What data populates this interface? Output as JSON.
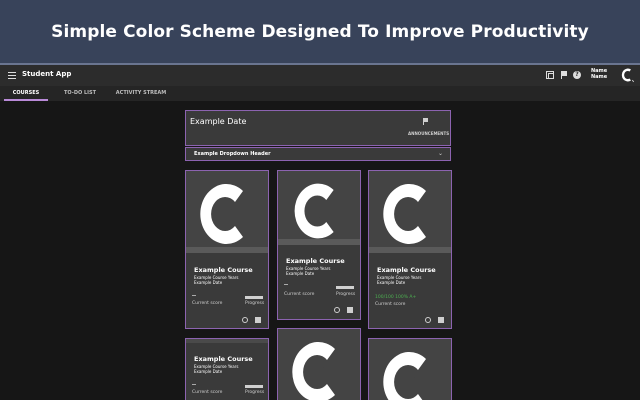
{
  "banner": {
    "text": "Simple Color Scheme Designed To Improve Productivity"
  },
  "app": {
    "title": "Student App",
    "user_name": "Name Name",
    "icons": [
      "menu-icon",
      "cards-icon",
      "flag-icon",
      "help-icon",
      "avatar-logo"
    ]
  },
  "tabs": [
    {
      "label": "COURSES",
      "active": true
    },
    {
      "label": "TO-DO LIST",
      "active": false
    },
    {
      "label": "ACTIVITY STREAM",
      "active": false
    }
  ],
  "date_card": {
    "title": "Example Date",
    "announcements_label": "ANNOUNCEMENTS"
  },
  "dropdown": {
    "label": "Example Dropdown Header"
  },
  "courses": [
    {
      "title": "Example Course",
      "years": "Example Course Years",
      "date": "Example Date",
      "score": "--",
      "score_label": "Current score",
      "progress_label": "Progress"
    },
    {
      "title": "Example Course",
      "years": "Example Course Years",
      "date": "Example Date",
      "score": "--",
      "score_label": "Current score",
      "progress_label": "Progress"
    },
    {
      "title": "Example Course",
      "years": "Example Course Years",
      "date": "Example Date",
      "score": "100/100 100% A+",
      "score_label": "Current score",
      "progress_label": ""
    },
    {
      "title": "Example Course",
      "years": "Example Course Years",
      "date": "Example Date",
      "score": "--",
      "score_label": "Current score",
      "progress_label": "Progress"
    }
  ],
  "colors": {
    "banner": "#38435a",
    "accent": "#b98ad8",
    "card_border": "#8c63b0",
    "card_bg": "#3a3a3a",
    "page_bg": "#161616",
    "grade": "#4caf50"
  }
}
